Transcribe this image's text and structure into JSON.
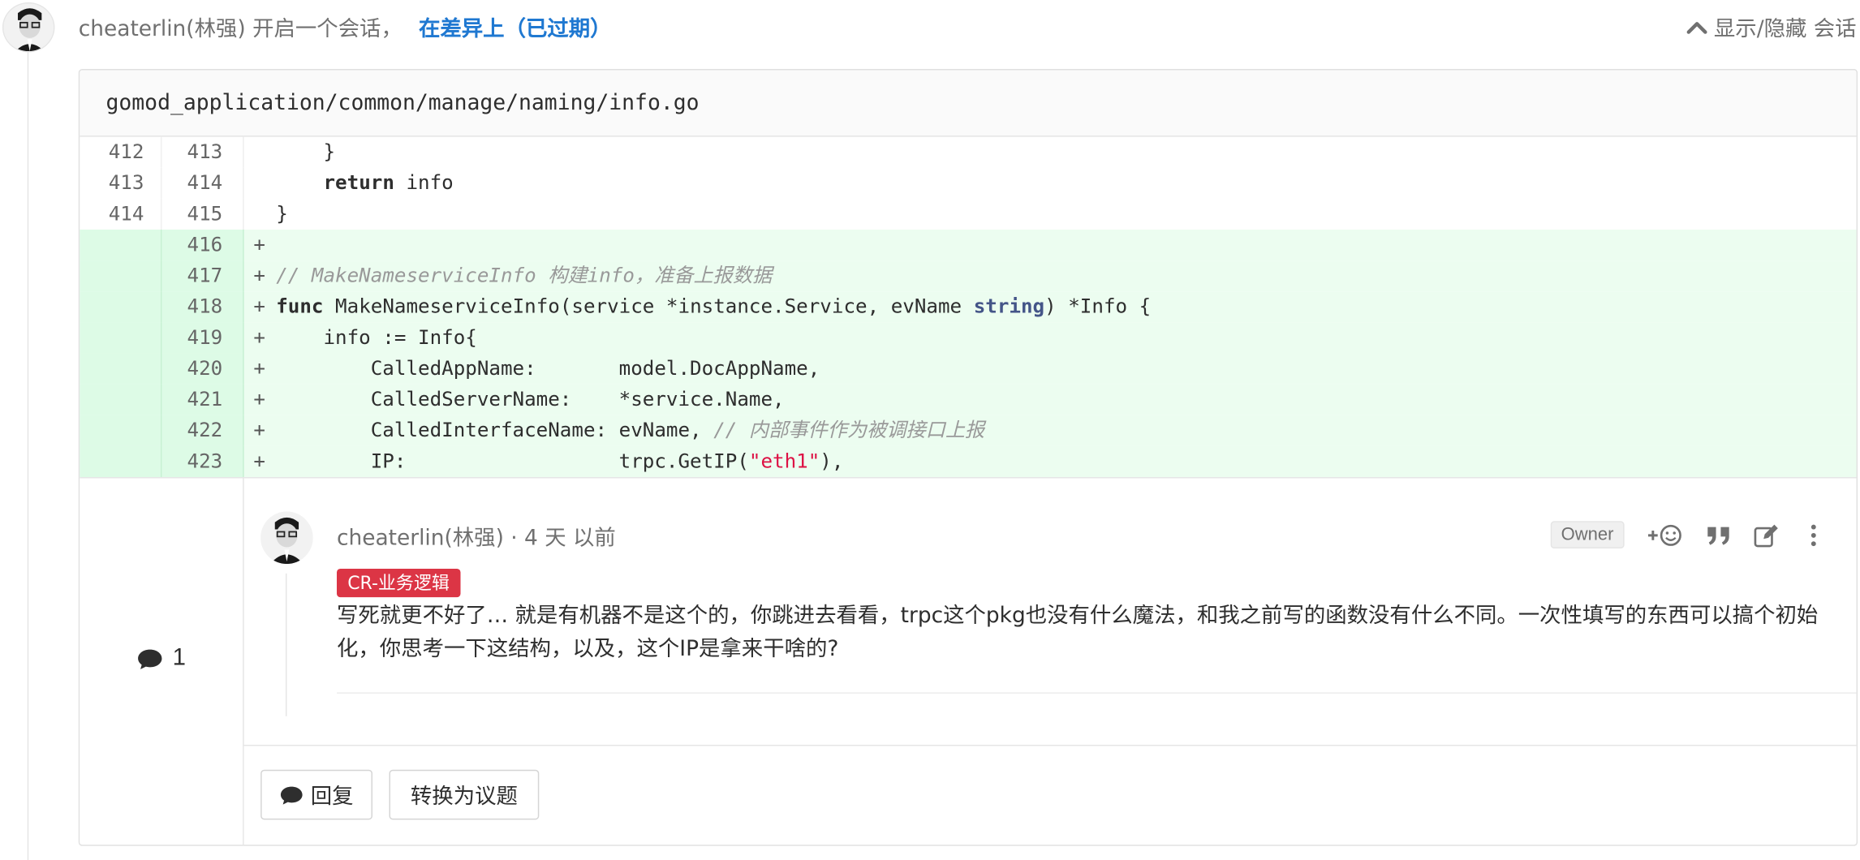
{
  "discussion": {
    "author": "cheaterlin(林强)",
    "started_text": "开启一个会话，",
    "diff_link": "在差异上（已过期）",
    "toggle_label": "显示/隐藏 会话"
  },
  "file": {
    "path": "gomod_application/common/manage/naming/info.go"
  },
  "lines": [
    {
      "old": "412",
      "new": "413",
      "added": false
    },
    {
      "old": "413",
      "new": "414",
      "added": false
    },
    {
      "old": "414",
      "new": "415",
      "added": false
    },
    {
      "old": "",
      "new": "416",
      "added": true
    },
    {
      "old": "",
      "new": "417",
      "added": true
    },
    {
      "old": "",
      "new": "418",
      "added": true
    },
    {
      "old": "",
      "new": "419",
      "added": true
    },
    {
      "old": "",
      "new": "420",
      "added": true
    },
    {
      "old": "",
      "new": "421",
      "added": true
    },
    {
      "old": "",
      "new": "422",
      "added": true
    },
    {
      "old": "",
      "new": "423",
      "added": true
    }
  ],
  "code": {
    "l0": "    }",
    "l1_kw": "return",
    "l1_rest": " info",
    "l2": "}",
    "plus": "+",
    "l4_comment": "// MakeNameserviceInfo 构建info，准备上报数据",
    "l5_kw": "func",
    "l5_a": " MakeNameserviceInfo(service *instance.Service, evName ",
    "l5_type": "string",
    "l5_b": ") *Info {",
    "l6": "    info := Info{",
    "l7": "        CalledAppName:       model.DocAppName,",
    "l8": "        CalledServerName:    *service.Name,",
    "l9_a": "        CalledInterfaceName: evName, ",
    "l9_comment": "// 内部事件作为被调接口上报",
    "l10_a": "        IP:                  trpc.GetIP(",
    "l10_str": "\"eth1\"",
    "l10_b": "),"
  },
  "notes": {
    "count": "1",
    "author": "cheaterlin(林强)",
    "time": " · 4 天 以前",
    "role_badge": "Owner",
    "label": "CR-业务逻辑",
    "text": "写死就更不好了… 就是有机器不是这个的，你跳进去看看，trpc这个pkg也没有什么魔法，和我之前写的函数没有什么不同。一次性填写的东西可以搞个初始化，你思考一下这结构，以及，这个IP是拿来干啥的?"
  },
  "buttons": {
    "reply": "回复",
    "convert": "转换为议题"
  },
  "icons": {
    "chevron": "chevron-up-icon",
    "comment": "comment-icon",
    "emoji": "add-emoji-icon",
    "quote": "quote-icon",
    "edit": "edit-icon",
    "more": "more-vertical-icon"
  },
  "colors": {
    "link": "#1f78d1",
    "added_bg": "#ecfdf0",
    "label_bg": "#dc3545"
  }
}
